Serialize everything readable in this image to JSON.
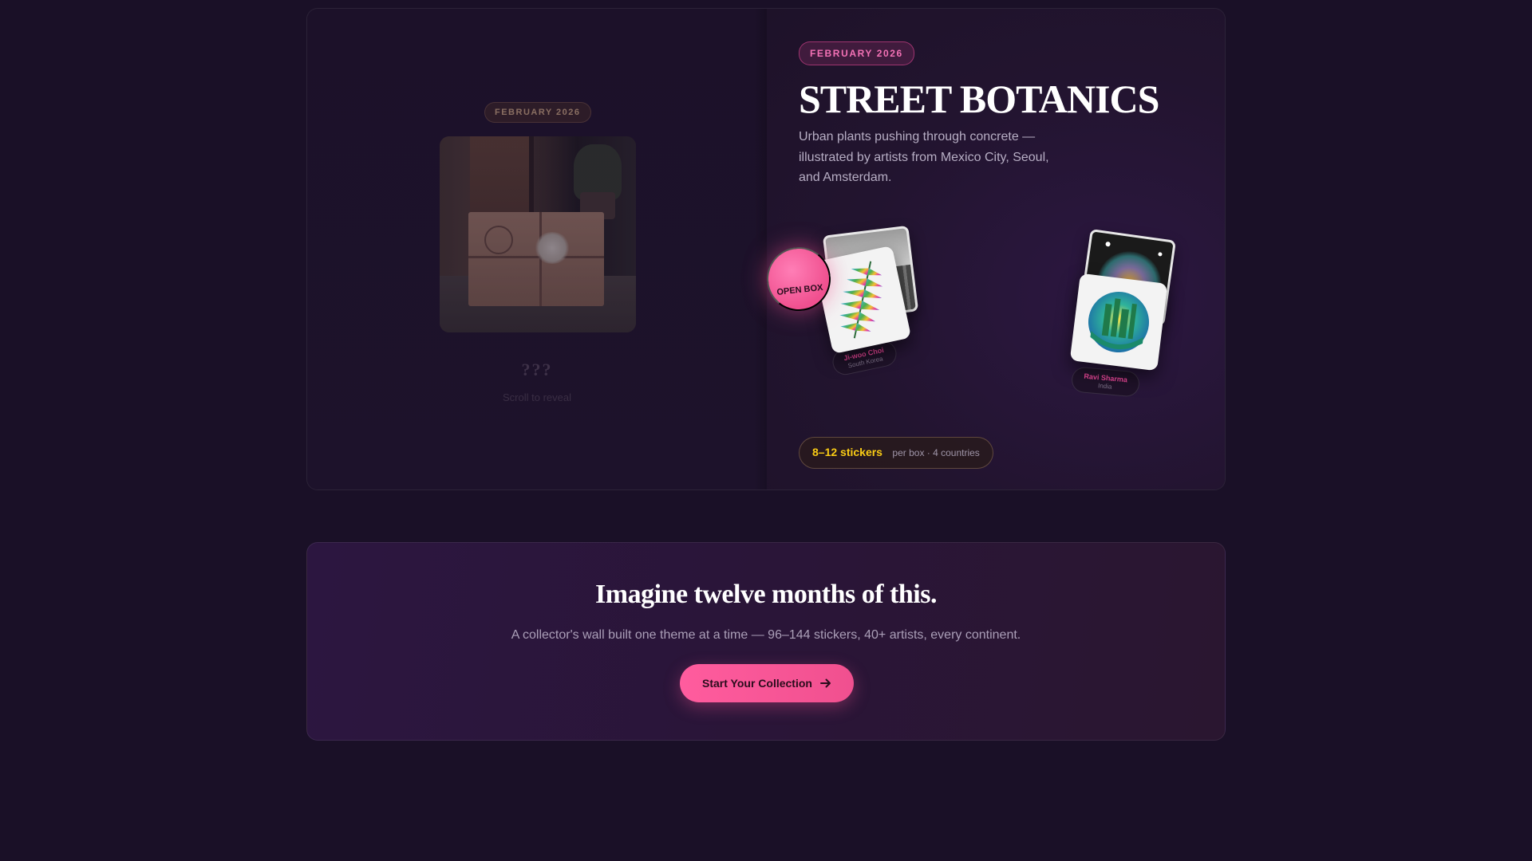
{
  "preview": {
    "badge": "FEBRUARY 2026",
    "mystery_title": "???",
    "mystery_hint": "Scroll to reveal"
  },
  "feature": {
    "badge": "FEBRUARY 2026",
    "title": "STREET BOTANICS",
    "description": "Urban plants pushing through concrete — illustrated by artists from Mexico City, Seoul, and Amsterdam.",
    "open_box_label": "OPEN BOX",
    "stickers": [
      {
        "artist": "Ji-woo Choi",
        "country": "South Korea",
        "icon": "fern-leaf-sticker"
      },
      {
        "artist": "Ravi Sharma",
        "country": "India",
        "icon": "city-globe-sticker"
      }
    ],
    "count_main": "8–12 stickers",
    "count_sub": "per box · 4 countries"
  },
  "cta": {
    "title": "Imagine twelve months of this.",
    "subtitle": "A collector's wall built one theme at a time — 96–144 stickers, 40+ artists, every continent.",
    "button_label": "Start Your Collection",
    "button_icon": "arrow-right-icon"
  },
  "colors": {
    "background": "#1a1027",
    "accent_pink": "#f0508f",
    "accent_yellow": "#facc15"
  }
}
